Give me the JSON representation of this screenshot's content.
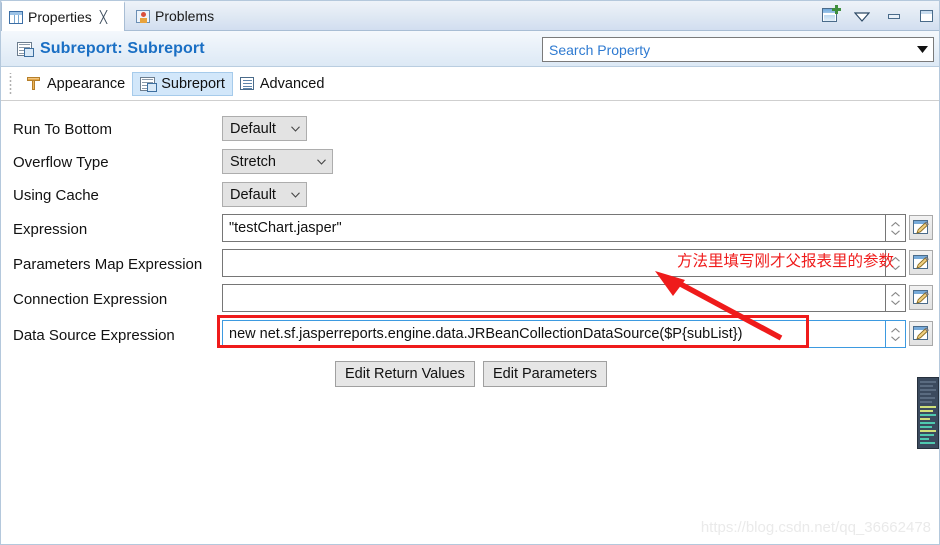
{
  "window": {
    "tabs": [
      {
        "label": "Properties",
        "icon": "table-icon",
        "active": true,
        "closeable": true
      },
      {
        "label": "Problems",
        "icon": "problems-icon",
        "active": false,
        "closeable": false
      }
    ],
    "toolbar_icons": [
      "new-view-icon",
      "view-menu-chevron-icon",
      "minimize-icon",
      "maximize-icon"
    ]
  },
  "header": {
    "title": "Subreport: Subreport",
    "title_color": "#1a6fc4",
    "icon": "subreport-icon"
  },
  "search": {
    "placeholder": "Search Property",
    "value": "",
    "dropdown_icon": "chevron-down-icon"
  },
  "subtabs": [
    {
      "label": "Appearance",
      "icon": "appearance-icon",
      "selected": false
    },
    {
      "label": "Subreport",
      "icon": "subreport-icon",
      "selected": true
    },
    {
      "label": "Advanced",
      "icon": "advanced-icon",
      "selected": false
    }
  ],
  "form": {
    "rows": [
      {
        "label": "Run To Bottom",
        "control": "combo",
        "value": "Default"
      },
      {
        "label": "Overflow Type",
        "control": "combo",
        "value": "Stretch"
      },
      {
        "label": "Using Cache",
        "control": "combo",
        "value": "Default"
      },
      {
        "label": "Expression",
        "control": "expr",
        "value": "\"testChart.jasper\""
      },
      {
        "label": "Parameters Map Expression",
        "control": "expr",
        "value": ""
      },
      {
        "label": "Connection Expression",
        "control": "expr",
        "value": ""
      },
      {
        "label": "Data Source Expression",
        "control": "expr",
        "value": "new net.sf.jasperreports.engine.data.JRBeanCollectionDataSource($P{subList})"
      }
    ],
    "buttons": [
      {
        "label": "Edit Return Values"
      },
      {
        "label": "Edit Parameters"
      }
    ],
    "edit_button_icon": "pencil-edit-icon",
    "spinner_icon": "spinner-updown-icon"
  },
  "annotations": {
    "note_text": "方法里填写刚才父报表里的参数",
    "note_color": "#ef1b1b",
    "highlight_color": "#ef1b1b",
    "arrow": "red-arrow-pointing-up-left"
  },
  "watermark": {
    "text": "https://blog.csdn.net/qq_36662478"
  }
}
